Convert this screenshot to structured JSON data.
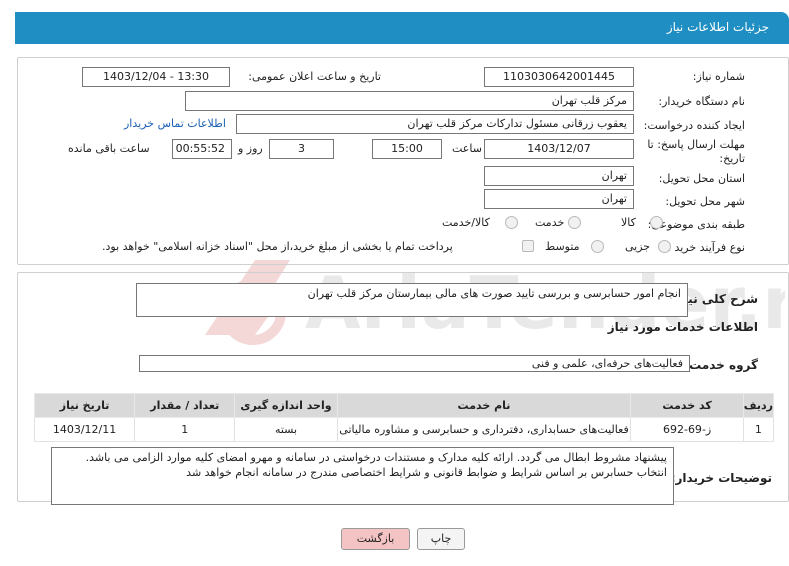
{
  "header": {
    "title": "جزئیات اطلاعات نیاز"
  },
  "form": {
    "need_number_label": "شماره نیاز:",
    "need_number": "1103030642001445",
    "announce_label": "تاریخ و ساعت اعلان عمومی:",
    "announce_value": "1403/12/04 - 13:30",
    "buyer_org_label": "نام دستگاه خریدار:",
    "buyer_org": "مرکز قلب تهران",
    "creator_label": "ایجاد کننده درخواست:",
    "creator": "یعقوب زرقانی مسئول تدارکات مرکز قلب تهران",
    "contact_link": "اطلاعات تماس خریدار",
    "deadline_label_1": "مهلت ارسال پاسخ: تا",
    "deadline_label_2": "تاریخ:",
    "deadline_date": "1403/12/07",
    "time_label": "ساعت",
    "deadline_time": "15:00",
    "days_value": "3",
    "days_label": "روز و",
    "remaining_time": "00:55:52",
    "remaining_label": "ساعت باقی مانده",
    "province_label": "استان محل تحویل:",
    "province": "تهران",
    "city_label": "شهر محل تحویل:",
    "city": "تهران",
    "category_label": "طبقه بندی موضوعی:",
    "category_options": [
      "کالا",
      "خدمت",
      "کالا/خدمت"
    ],
    "process_label": "نوع فرآیند خرید :",
    "process_options": [
      "جزیی",
      "متوسط"
    ],
    "payment_note": "پرداخت تمام یا بخشی از مبلغ خرید،از محل \"اسناد خزانه اسلامی\" خواهد بود."
  },
  "details": {
    "summary_label": "شرح کلی نیاز:",
    "summary": "انجام امور حسابرسی و بررسی  تایید صورت های مالی بیمارستان مرکز قلب تهران",
    "services_heading": "اطلاعات خدمات مورد نیاز",
    "service_group_label": "گروه خدمت:",
    "service_group": "فعالیت‌های حرفه‌ای، علمی و فنی",
    "table": {
      "headers": [
        "ردیف",
        "کد خدمت",
        "نام خدمت",
        "واحد اندازه گیری",
        "تعداد / مقدار",
        "تاریخ نیاز"
      ],
      "rows": [
        [
          "1",
          "ز-69-692",
          "فعالیت‌های حسابداری، دفترداری و حسابرسی و مشاوره مالیاتی",
          "بسته",
          "1",
          "1403/12/11"
        ]
      ]
    },
    "buyer_notes_label": "توضیحات خریدار:",
    "buyer_notes": "پیشنهاد مشروط ابطال می گردد. ارائه کلیه مدارک و مستندات درخواستی در سامانه و مهرو امضای کلیه موارد الزامی می باشد. انتخاب حسابرس بر اساس شرایط و ضوابط قانونی و شرایط اختصاصی  مندرج در سامانه انجام خواهد شد"
  },
  "buttons": {
    "print": "چاپ",
    "back": "بازگشت"
  },
  "watermark_text": "AriaTender.neT",
  "colors": {
    "header": "#1f8ec2",
    "link": "#1a5fb4",
    "back_button": "#f4c4c4"
  }
}
